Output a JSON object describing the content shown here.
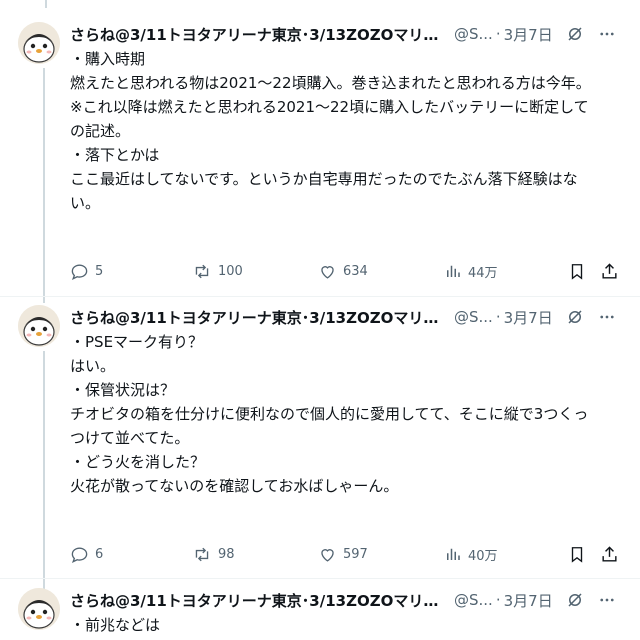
{
  "tweets": [
    {
      "name": "さらね@3/11トヨタアリーナ東京･3/13ZOZOマリン…",
      "handle": "@S...",
      "dot": "·",
      "date": "3月7日",
      "lines": [
        "・購入時期",
        "燃えたと思われる物は2021〜22頃購入。巻き込まれたと思われる方は今年。",
        "",
        "※これ以降は燃えたと思われる2021〜22頃に購入したバッテリーに断定して",
        "の記述。",
        "",
        "・落下とかは",
        "ここ最近はしてないです。というか自宅専用だったのでたぶん落下経験はな",
        "い。"
      ],
      "replies": "5",
      "retweets": "100",
      "likes": "634",
      "views": "44万"
    },
    {
      "name": "さらね@3/11トヨタアリーナ東京･3/13ZOZOマリン…",
      "handle": "@S...",
      "dot": "·",
      "date": "3月7日",
      "lines": [
        "・PSEマーク有り？",
        "はい。",
        "",
        "・保管状況は？",
        "チオビタの箱を仕分けに便利なので個人的に愛用してて、そこに縦で3つくっ",
        "つけて並べてた。",
        "",
        "・どう火を消した？",
        "火花が散ってないのを確認してお水ばしゃーん。"
      ],
      "replies": "6",
      "retweets": "98",
      "likes": "597",
      "views": "40万"
    },
    {
      "name": "さらね@3/11トヨタアリーナ東京･3/13ZOZOマリン…",
      "handle": "@S...",
      "dot": "·",
      "date": "3月7日",
      "lines": [
        "・前兆などは"
      ]
    }
  ],
  "icons": {
    "reply": "reply-icon",
    "retweet": "retweet-icon",
    "like": "heart-icon",
    "views": "views-icon",
    "bookmark": "bookmark-icon",
    "share": "share-icon",
    "grok": "grok-icon",
    "more": "more-icon"
  },
  "colors": {
    "text": "#0f1419",
    "secondary": "#536471",
    "divider": "#eff3f4",
    "thread": "#cfd9de"
  }
}
